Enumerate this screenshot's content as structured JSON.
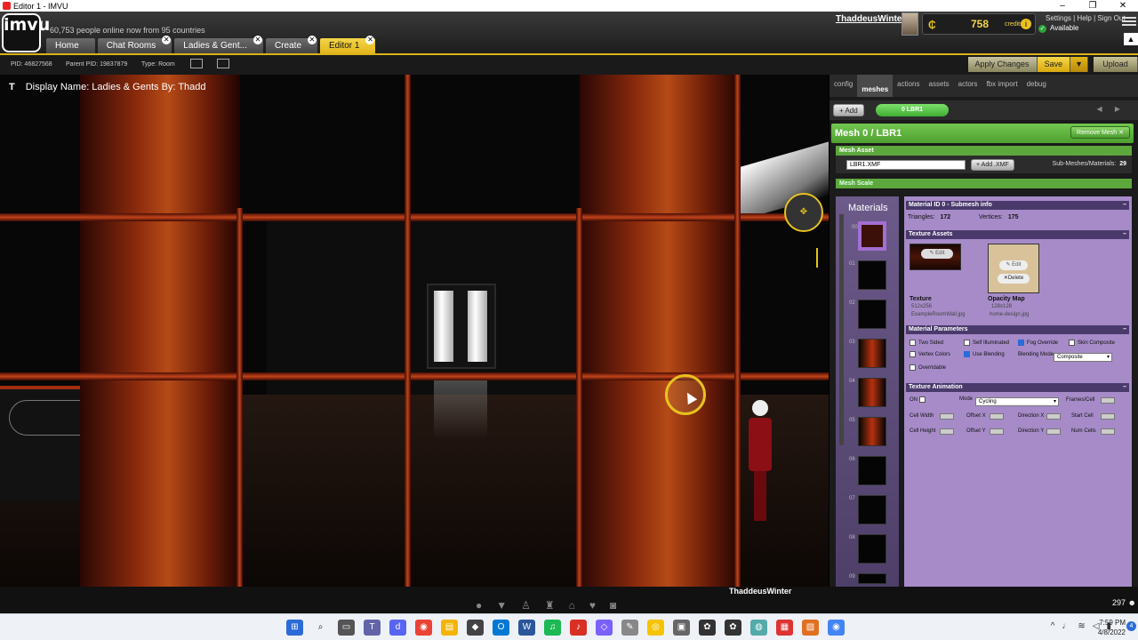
{
  "window": {
    "title": "Editor 1 - IMVU"
  },
  "header": {
    "logo": "imvu",
    "online_text": "60,753 people online now from 95 countries",
    "tabs": [
      {
        "label": "Home",
        "closable": false
      },
      {
        "label": "Chat Rooms",
        "closable": true
      },
      {
        "label": "Ladies & Gent...",
        "closable": true
      },
      {
        "label": "Create",
        "closable": true
      },
      {
        "label": "Editor 1",
        "closable": true,
        "active": true
      }
    ],
    "username": "ThaddeusWinter",
    "credits_value": "758",
    "credits_label": "credits",
    "status": "Available",
    "links": "Settings | Help | Sign Out",
    "notification_count": "1"
  },
  "idbar": {
    "pid": "PID: 46827568",
    "parent_pid": "Parent PID: 19837879",
    "type": "Type: Room"
  },
  "actions": {
    "apply": "Apply Changes",
    "save": "Save",
    "upload": "Upload"
  },
  "viewport": {
    "display_name": "Display Name: Ladies & Gents By: Thadd"
  },
  "panel": {
    "tabs": [
      "config",
      "meshes",
      "actions",
      "assets",
      "actors",
      "fbx import",
      "debug"
    ],
    "active_tab": "meshes",
    "add_label": "Add",
    "mesh_pill": "0 LBR1",
    "mesh_title": "Mesh 0 / LBR1",
    "remove_mesh": "Remove Mesh",
    "mesh_asset_header": "Mesh Asset",
    "mesh_file": "LBR1.XMF",
    "add_xmf": "Add .XMF",
    "submeshes_label": "Sub-Meshes/Materials:",
    "submeshes_value": "29",
    "mesh_scale_header": "Mesh Scale",
    "materials_title": "Materials",
    "swatch_numbers": [
      "00",
      "01",
      "02",
      "03",
      "04",
      "05",
      "06",
      "07",
      "08",
      "09"
    ],
    "material_header": "Material ID 0 - Submesh info",
    "triangles_label": "Triangles:",
    "triangles_value": "172",
    "vertices_label": "Vertices:",
    "vertices_value": "175",
    "texture_assets_header": "Texture Assets",
    "edit_label": "Edit",
    "delete_label": "Delete",
    "texture_label": "Texture",
    "texture_size": "512x256",
    "texture_file": "ExampleRoomWall.jpg",
    "opacity_label": "Opacity Map",
    "opacity_size": "128x128",
    "opacity_file": "home-design.jpg",
    "material_params_header": "Material Parameters",
    "params": {
      "two_sided": "Two Sided",
      "self_illuminated": "Self Illuminated",
      "fog_override": "Fog Override",
      "skin_composite": "Skin Composite",
      "vertex_colors": "Vertex Colors",
      "use_blending": "Use Blending",
      "blending_mode_label": "Blending Mode",
      "blending_mode_value": "Composite",
      "overridable": "Overridable"
    },
    "texture_anim_header": "Texture Animation",
    "anim": {
      "on": "ON",
      "mode_label": "Mode",
      "mode_value": "Cycling",
      "frames_cell": "Frames/Cell",
      "cell_width": "Cell Width",
      "offset_x": "Offset X",
      "direction_x": "Direction X",
      "start_cell": "Start Cell",
      "cell_height": "Cell Height",
      "offset_y": "Offset Y",
      "direction_y": "Direction Y",
      "num_cells": "Num Cells"
    }
  },
  "bottombar": {
    "username": "ThaddeusWinter",
    "user_count": "297"
  },
  "taskbar": {
    "time": "7:59 PM",
    "date": "4/8/2022",
    "notif": "4"
  }
}
